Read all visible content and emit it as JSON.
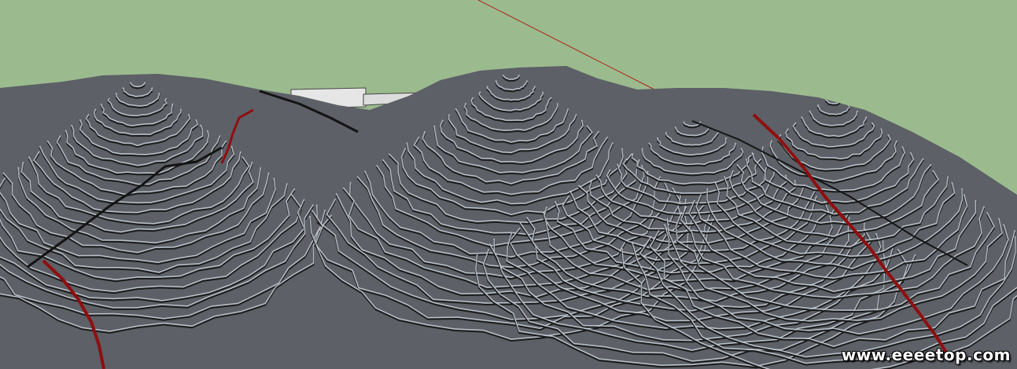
{
  "scene": {
    "sky_color": "#9bbb8e",
    "terrain_base_color": "#5d6066",
    "terrace_edge_color": "#c9d2dc",
    "terrace_shadow_color": "#1c1c1c",
    "axis_line_color": "#b0201c",
    "path_line_color": "#8e0f0f",
    "building_color": "#e4e4e4"
  },
  "watermark": {
    "text": "www.eeeetop.com"
  }
}
